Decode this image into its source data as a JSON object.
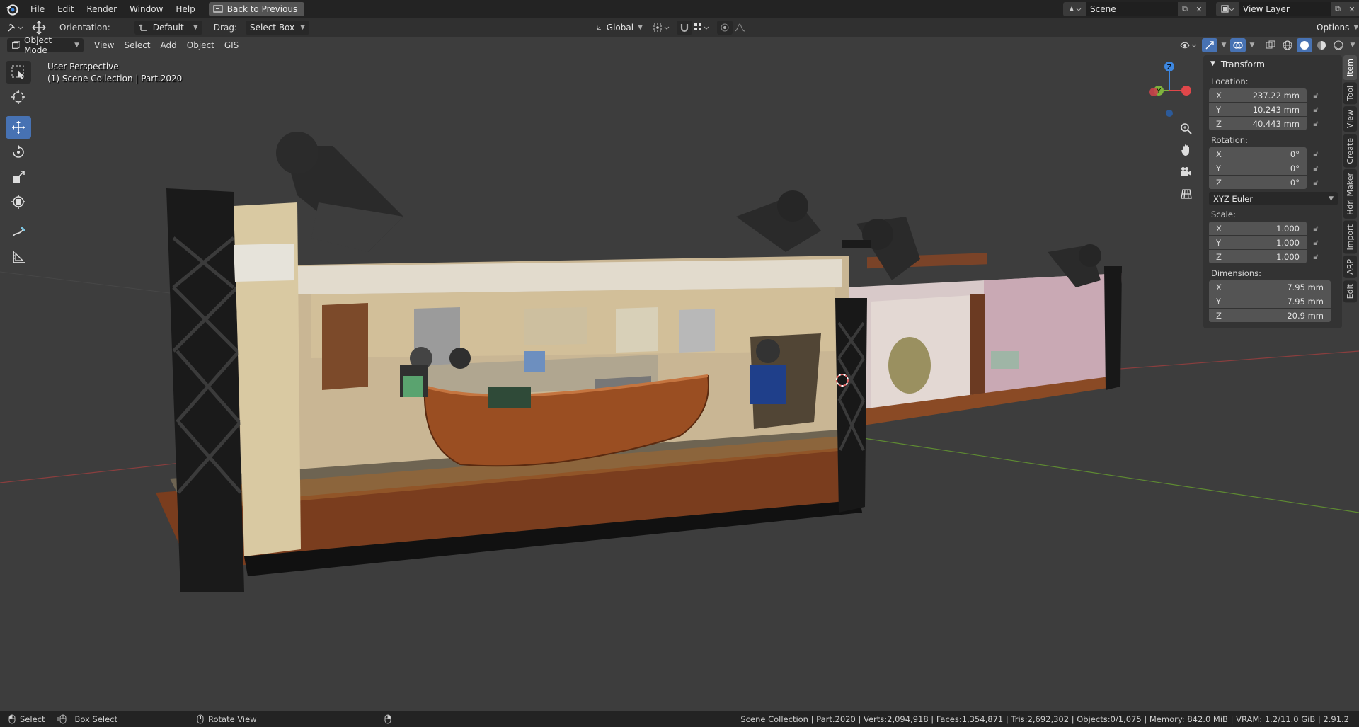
{
  "menubar": {
    "items": [
      "File",
      "Edit",
      "Render",
      "Window",
      "Help"
    ],
    "back_button": "Back to Previous",
    "scene_name": "Scene",
    "view_layer": "View Layer"
  },
  "header": {
    "orientation_label": "Orientation:",
    "orientation_value": "Default",
    "drag_label": "Drag:",
    "drag_value": "Select Box",
    "transform_orientation": "Global",
    "options_label": "Options"
  },
  "modebar": {
    "mode": "Object Mode",
    "items": [
      "View",
      "Select",
      "Add",
      "Object",
      "GIS"
    ]
  },
  "viewport": {
    "perspective": "User Perspective",
    "collection_info": "(1) Scene Collection | Part.2020"
  },
  "gizmo": {
    "x": "X",
    "y": "Y",
    "z": "Z"
  },
  "transform_panel": {
    "title": "Transform",
    "location_label": "Location:",
    "location": [
      {
        "axis": "X",
        "value": "237.22 mm"
      },
      {
        "axis": "Y",
        "value": "10.243 mm"
      },
      {
        "axis": "Z",
        "value": "40.443 mm"
      }
    ],
    "rotation_label": "Rotation:",
    "rotation": [
      {
        "axis": "X",
        "value": "0°"
      },
      {
        "axis": "Y",
        "value": "0°"
      },
      {
        "axis": "Z",
        "value": "0°"
      }
    ],
    "rotation_mode": "XYZ Euler",
    "scale_label": "Scale:",
    "scale": [
      {
        "axis": "X",
        "value": "1.000"
      },
      {
        "axis": "Y",
        "value": "1.000"
      },
      {
        "axis": "Z",
        "value": "1.000"
      }
    ],
    "dimensions_label": "Dimensions:",
    "dimensions": [
      {
        "axis": "X",
        "value": "7.95 mm"
      },
      {
        "axis": "Y",
        "value": "7.95 mm"
      },
      {
        "axis": "Z",
        "value": "20.9 mm"
      }
    ]
  },
  "side_tabs": [
    "Item",
    "Tool",
    "View",
    "Create",
    "Hdri Maker",
    "Import",
    "ARP",
    "Edit"
  ],
  "statusbar": {
    "select": "Select",
    "box_select": "Box Select",
    "rotate_view": "Rotate View",
    "stats": "Scene Collection | Part.2020 | Verts:2,094,918 | Faces:1,354,871 | Tris:2,692,302 | Objects:0/1,075 | Memory: 842.0 MiB | VRAM: 1.2/11.0 GiB | 2.91.2"
  },
  "colors": {
    "accent": "#4772b3",
    "x_axis": "#e0474a",
    "y_axis": "#7fb23d",
    "z_axis": "#3d87e0"
  }
}
